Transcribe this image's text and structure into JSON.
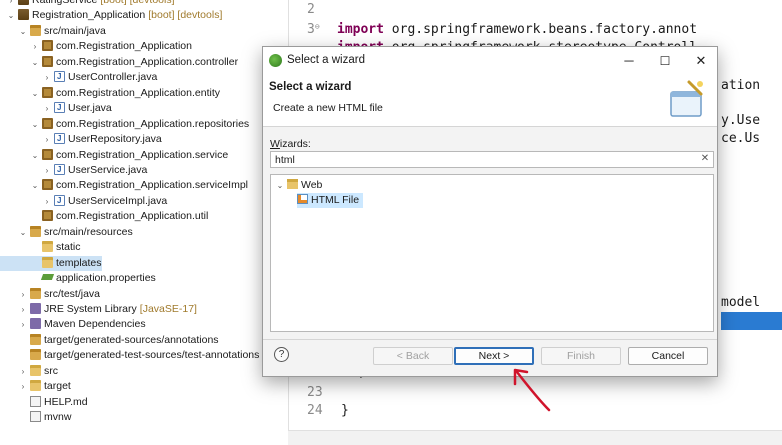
{
  "explorer": {
    "rows": [
      {
        "label": "RatingService",
        "deco": "[boot] [devtools]",
        "indent": 0,
        "twisty": "›",
        "icon": "project-icon"
      },
      {
        "label": "Registration_Application",
        "deco": "[boot] [devtools]",
        "indent": 0,
        "twisty": "⌄",
        "icon": "project-icon"
      },
      {
        "label": "src/main/java",
        "deco": "",
        "indent": 1,
        "twisty": "⌄",
        "icon": "source-folder-icon"
      },
      {
        "label": "com.Registration_Application",
        "deco": "",
        "indent": 2,
        "twisty": "›",
        "icon": "package-icon"
      },
      {
        "label": "com.Registration_Application.controller",
        "deco": "",
        "indent": 2,
        "twisty": "⌄",
        "icon": "package-icon"
      },
      {
        "label": "UserController.java",
        "deco": "",
        "indent": 3,
        "twisty": "›",
        "icon": "java-file-icon"
      },
      {
        "label": "com.Registration_Application.entity",
        "deco": "",
        "indent": 2,
        "twisty": "⌄",
        "icon": "package-icon"
      },
      {
        "label": "User.java",
        "deco": "",
        "indent": 3,
        "twisty": "›",
        "icon": "java-file-icon"
      },
      {
        "label": "com.Registration_Application.repositories",
        "deco": "",
        "indent": 2,
        "twisty": "⌄",
        "icon": "package-icon"
      },
      {
        "label": "UserRepository.java",
        "deco": "",
        "indent": 3,
        "twisty": "›",
        "icon": "java-file-icon"
      },
      {
        "label": "com.Registration_Application.service",
        "deco": "",
        "indent": 2,
        "twisty": "⌄",
        "icon": "package-icon"
      },
      {
        "label": "UserService.java",
        "deco": "",
        "indent": 3,
        "twisty": "›",
        "icon": "java-file-icon"
      },
      {
        "label": "com.Registration_Application.serviceImpl",
        "deco": "",
        "indent": 2,
        "twisty": "⌄",
        "icon": "package-icon"
      },
      {
        "label": "UserServiceImpl.java",
        "deco": "",
        "indent": 3,
        "twisty": "›",
        "icon": "java-file-icon"
      },
      {
        "label": "com.Registration_Application.util",
        "deco": "",
        "indent": 2,
        "twisty": "",
        "icon": "package-icon"
      },
      {
        "label": "src/main/resources",
        "deco": "",
        "indent": 1,
        "twisty": "⌄",
        "icon": "source-folder-icon"
      },
      {
        "label": "static",
        "deco": "",
        "indent": 2,
        "twisty": "",
        "icon": "folder-icon"
      },
      {
        "label": "templates",
        "deco": "",
        "indent": 2,
        "twisty": "",
        "icon": "folder-icon",
        "selected": true
      },
      {
        "label": "application.properties",
        "deco": "",
        "indent": 2,
        "twisty": "",
        "icon": "properties-file-icon"
      },
      {
        "label": "src/test/java",
        "deco": "",
        "indent": 1,
        "twisty": "›",
        "icon": "source-folder-icon"
      },
      {
        "label": "JRE System Library",
        "deco": "[JavaSE-17]",
        "indent": 1,
        "twisty": "›",
        "icon": "library-icon"
      },
      {
        "label": "Maven Dependencies",
        "deco": "",
        "indent": 1,
        "twisty": "›",
        "icon": "library-icon"
      },
      {
        "label": "target/generated-sources/annotations",
        "deco": "",
        "indent": 1,
        "twisty": "",
        "icon": "source-folder-icon"
      },
      {
        "label": "target/generated-test-sources/test-annotations",
        "deco": "",
        "indent": 1,
        "twisty": "",
        "icon": "source-folder-icon"
      },
      {
        "label": "src",
        "deco": "",
        "indent": 1,
        "twisty": "›",
        "icon": "folder-icon"
      },
      {
        "label": "target",
        "deco": "",
        "indent": 1,
        "twisty": "›",
        "icon": "folder-icon"
      },
      {
        "label": "HELP.md",
        "deco": "",
        "indent": 1,
        "twisty": "",
        "icon": "file-icon"
      },
      {
        "label": "mvnw",
        "deco": "",
        "indent": 1,
        "twisty": "",
        "icon": "file-icon"
      }
    ]
  },
  "editor": {
    "line_numbers": [
      "2",
      "3",
      "23",
      "24"
    ],
    "import_keyword": "import",
    "line3_code": " org.springframework.beans.factory.annot",
    "line4_code": " org.springframework.stereotype.Controll",
    "right_fragments": [
      "ation",
      "y.Use",
      "ce.Us",
      "model"
    ],
    "brace": "}",
    "small_brace": "}"
  },
  "dialog": {
    "title": "Select a wizard",
    "minimize": "─",
    "maximize": "☐",
    "close": "✕",
    "banner_title": "Select a wizard",
    "banner_subtitle": "Create a new HTML file",
    "wizards_label": "Wizards:",
    "filter_value": "html",
    "filter_clear": "✕",
    "tree": {
      "category": "Web",
      "item": "HTML File"
    },
    "help": "?",
    "buttons": {
      "back": "< Back",
      "next": "Next >",
      "finish": "Finish",
      "cancel": "Cancel"
    }
  },
  "colors": {
    "selection": "#cce8ff",
    "default_button_border": "#2f6fb8",
    "annotation_arrow": "#d0142c",
    "keyword": "#7f0055"
  }
}
